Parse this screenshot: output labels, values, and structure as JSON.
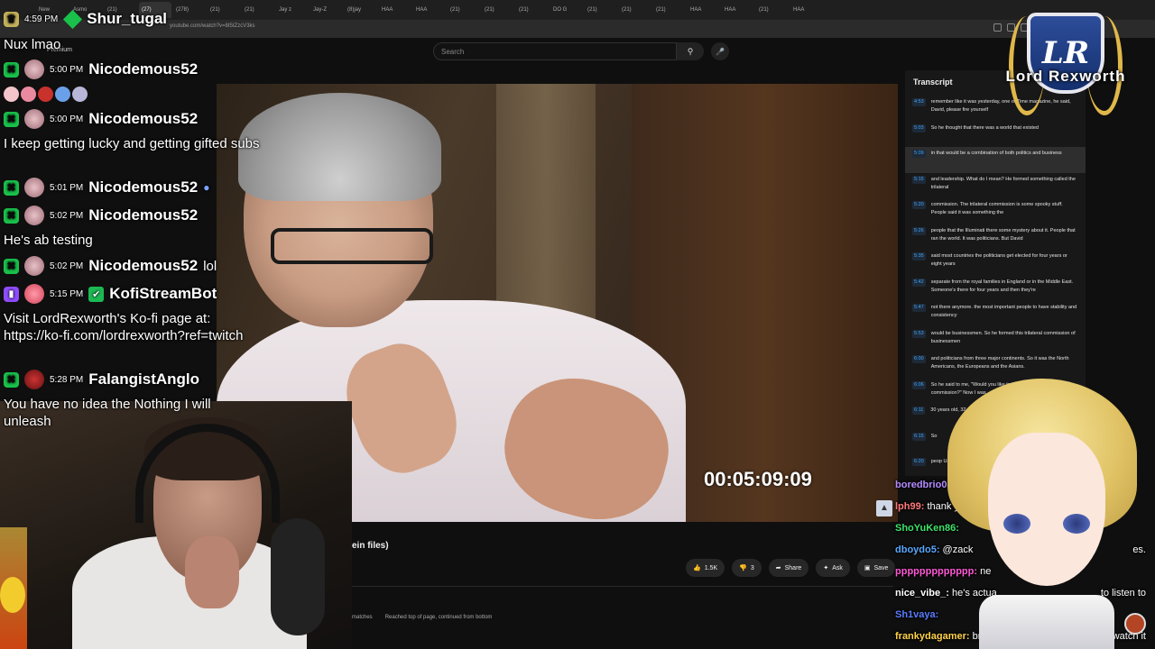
{
  "browser": {
    "url": "youtube.com/watch?v=8t5tZzcV3ks",
    "tabs": [
      "New",
      "Asmo",
      "(21)",
      "(27)",
      "(278)",
      "(21)",
      "(21)",
      "Jay z",
      "Jay-Z",
      "(8)jay",
      "HAA",
      "HAA",
      "(21)",
      "(21)",
      "(21)",
      "DO G",
      "(21)",
      "(21)",
      "(21)",
      "HAA",
      "HAA",
      "(21)",
      "HAA"
    ]
  },
  "youtube": {
    "premium_label": "Premium",
    "search_placeholder": "Search",
    "video_title_fragment": "ein files)",
    "timecode": "00:05:09:09",
    "likes": "1.5K",
    "dislikes": "3",
    "share_label": "Share",
    "ask_label": "Ask",
    "save_label": "Save",
    "status_matches": "matches",
    "status_message": "Reached top of page, continued from bottom"
  },
  "transcript": {
    "title": "Transcript",
    "rows": [
      {
        "ts": "4:53",
        "text": "remember like it was yesterday, one of Time magazine, he said, David, please fire yourself"
      },
      {
        "ts": "5:03",
        "text": "So he thought that there was a world that existed"
      },
      {
        "ts": "5:09",
        "text": "in that would be a combination of both politics and business",
        "highlight": true
      },
      {
        "ts": "5:15",
        "text": "and leadership. What do I mean? He formed something called the trilateral"
      },
      {
        "ts": "5:20",
        "text": "commission. The trilateral commission is some spooky stuff. People said it was something the"
      },
      {
        "ts": "5:26",
        "text": "people that the Illuminati there some mystery about it. People that ran the world. It was politicians. But David"
      },
      {
        "ts": "5:35",
        "text": "said most countries the politicians get elected for four years or eight years"
      },
      {
        "ts": "5:42",
        "text": "separate from the royal families in England or in the Middle East. Someone's there for four years and then they're"
      },
      {
        "ts": "5:47",
        "text": "not there anymore. the most important people to have stability and consistency"
      },
      {
        "ts": "5:53",
        "text": "would be businessmen. So he formed this trilateral commission of businessmen"
      },
      {
        "ts": "6:00",
        "text": "and politicians from three major continents. So it was the North Americans, the Europeans and the Asians."
      },
      {
        "ts": "6:06",
        "text": "So he said to me, \"Would you like to be on the trilateral commission?\" Now I was"
      },
      {
        "ts": "6:11",
        "text": "30 years old, 32 years you have to"
      },
      {
        "ts": "6:15",
        "text": "So"
      },
      {
        "ts": "6:20",
        "text": "peop Unite"
      }
    ]
  },
  "chat": {
    "messages": [
      {
        "time": "4:59 PM",
        "user": "Shur_tugal",
        "text": "Nux lmao"
      },
      {
        "time": "5:00 PM",
        "user": "Nicodemous52",
        "text": ""
      },
      {
        "time": "5:00 PM",
        "user": "Nicodemous52",
        "text": "I keep getting lucky and getting gifted subs"
      },
      {
        "time": "5:01 PM",
        "user": "Nicodemous52",
        "text": ""
      },
      {
        "time": "5:02 PM",
        "user": "Nicodemous52",
        "text": "He's ab testing"
      },
      {
        "time": "5:02 PM",
        "user": "Nicodemous52",
        "inline": "lol"
      },
      {
        "time": "5:15 PM",
        "user": "KofiStreamBot",
        "text": "Visit LordRexworth's Ko-fi page at: https://ko-fi.com/lordrexworth?ref=twitch"
      },
      {
        "time": "5:28 PM",
        "user": "FalangistAnglo",
        "text": "You have no idea the Nothing I will unleash"
      }
    ],
    "emote_colors": [
      "#f3c4c9",
      "#e98aa0",
      "#c9312d",
      "#6aa0e8",
      "#b8b6d8"
    ]
  },
  "chat2": {
    "rows": [
      {
        "name": "boredbrio0",
        "msg": "",
        "color": "#b58cff"
      },
      {
        "name": "lph99:",
        "msg": " thank y",
        "color": "#ff7a7a"
      },
      {
        "name": "ShoYuKen86:",
        "msg": "",
        "color": "#3fe36a"
      },
      {
        "name": "dboydo5:",
        "msg": " @zack",
        "color": "#5aa8ff"
      },
      {
        "name": "ppppppppppppp:",
        "msg": " ne",
        "color": "#ff5ad6"
      },
      {
        "name": "nice_vibe_:",
        "msg": " he's actua",
        "color": "#ffffff"
      },
      {
        "name": "Sh1vaya:",
        "msg": "",
        "color": "#5a7dff"
      },
      {
        "name": "frankydagamer:",
        "msg": " br",
        "color": "#ffd24a"
      }
    ],
    "overflow_right": [
      {
        "text": "es."
      },
      {
        "text": "to listen to"
      },
      {
        "text": "to watch it"
      }
    ]
  },
  "logo": {
    "text": "Lord Rexworth",
    "monogram": "LR"
  }
}
